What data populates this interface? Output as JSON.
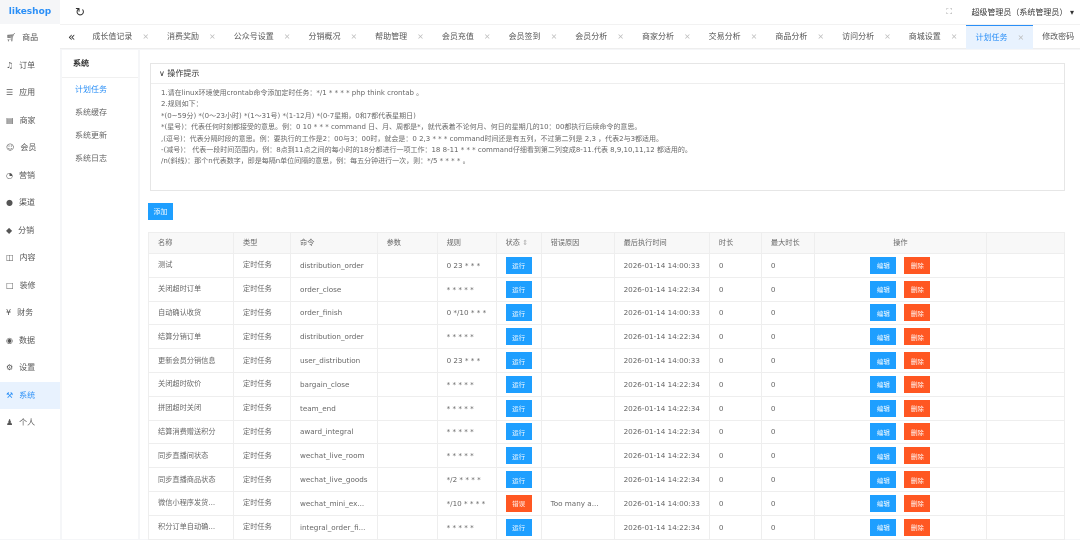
{
  "app": {
    "logo": "likeshop",
    "user": "超级管理员（系统管理员）"
  },
  "sidebar": {
    "items": [
      {
        "icon": "cart-icon",
        "label": "商品"
      },
      {
        "icon": "bell-icon",
        "label": "订单"
      },
      {
        "icon": "apps-icon",
        "label": "应用"
      },
      {
        "icon": "store-icon",
        "label": "商家"
      },
      {
        "icon": "user-icon",
        "label": "会员"
      },
      {
        "icon": "marketing-icon",
        "label": "营销"
      },
      {
        "icon": "channel-icon",
        "label": "渠道"
      },
      {
        "icon": "distribution-icon",
        "label": "分销"
      },
      {
        "icon": "content-icon",
        "label": "内容"
      },
      {
        "icon": "decor-icon",
        "label": "装修"
      },
      {
        "icon": "finance-icon",
        "label": "财务"
      },
      {
        "icon": "data-icon",
        "label": "数据"
      },
      {
        "icon": "settings-icon",
        "label": "设置"
      },
      {
        "icon": "system-icon",
        "label": "系统"
      },
      {
        "icon": "person-icon",
        "label": "个人"
      }
    ]
  },
  "submenu": {
    "title": "系统",
    "items": [
      "计划任务",
      "系统缓存",
      "系统更新",
      "系统日志"
    ]
  },
  "tabs": [
    "成长值记录",
    "消费奖励",
    "公众号设置",
    "分销概况",
    "帮助管理",
    "会员充值",
    "会员签到",
    "会员分析",
    "商家分析",
    "交易分析",
    "商品分析",
    "访问分析",
    "商城设置",
    "计划任务",
    "修改密码"
  ],
  "tips": {
    "title": "操作提示",
    "lines": [
      "1.请在linux环境使用crontab命令添加定时任务：*/1 * * * * php think crontab 。",
      "2.规则如下：",
      "*(0~59分) *(0～23小时) *(1～31号) *(1-12月) *(0-7星期，0和7都代表星期日)",
      "*(星号)：代表任何时刻都接受的意思。例：0 10 * * * command 日、月、周都是*，就代表着不论何月、何日的星期几的10：00都执行后续命令的意思。",
      ",(逗号)：代表分隔时段的意思。例：要执行的工作是2：00与3：00时，就会是：0 2,3 * * * command时间还是有五列，不过第二列是 2,3 ，代表2与3都适用。",
      "-(减号)： 代表一段时间范围内，例：8点到11点之间的每小时的18分都进行一项工作：18 8-11 * * * command仔细看到第二列变成8-11.代表 8,9,10,11,12 都适用的。",
      "/n(斜线)：那个n代表数字，即是每隔n单位间隔的意思，例：每五分钟进行一次，则：*/5 * * * * 。"
    ]
  },
  "add_label": "添加",
  "table": {
    "headers": [
      "名称",
      "类型",
      "命令",
      "参数",
      "规则",
      "状态",
      "错误原因",
      "最后执行时间",
      "时长",
      "最大时长",
      "操作"
    ],
    "edit_label": "编辑",
    "delete_label": "删除",
    "rows": [
      {
        "name": "测试",
        "type": "定时任务",
        "cmd": "distribution_order",
        "params": "",
        "rule": "0 23 * * *",
        "status": "运行",
        "error": "",
        "last": "2026-01-14 14:00:33",
        "dur": "0",
        "max": "0"
      },
      {
        "name": "关闭超时订单",
        "type": "定时任务",
        "cmd": "order_close",
        "params": "",
        "rule": "* * * * *",
        "status": "运行",
        "error": "",
        "last": "2026-01-14 14:22:34",
        "dur": "0",
        "max": "0"
      },
      {
        "name": "自动确认收货",
        "type": "定时任务",
        "cmd": "order_finish",
        "params": "",
        "rule": "0 */10 * * *",
        "status": "运行",
        "error": "",
        "last": "2026-01-14 14:00:33",
        "dur": "0",
        "max": "0"
      },
      {
        "name": "结算分销订单",
        "type": "定时任务",
        "cmd": "distribution_order",
        "params": "",
        "rule": "* * * * *",
        "status": "运行",
        "error": "",
        "last": "2026-01-14 14:22:34",
        "dur": "0",
        "max": "0"
      },
      {
        "name": "更新会员分销信息",
        "type": "定时任务",
        "cmd": "user_distribution",
        "params": "",
        "rule": "0 23 * * *",
        "status": "运行",
        "error": "",
        "last": "2026-01-14 14:00:33",
        "dur": "0",
        "max": "0"
      },
      {
        "name": "关闭超时砍价",
        "type": "定时任务",
        "cmd": "bargain_close",
        "params": "",
        "rule": "* * * * *",
        "status": "运行",
        "error": "",
        "last": "2026-01-14 14:22:34",
        "dur": "0",
        "max": "0"
      },
      {
        "name": "拼团超时关闭",
        "type": "定时任务",
        "cmd": "team_end",
        "params": "",
        "rule": "* * * * *",
        "status": "运行",
        "error": "",
        "last": "2026-01-14 14:22:34",
        "dur": "0",
        "max": "0"
      },
      {
        "name": "结算消费赠送积分",
        "type": "定时任务",
        "cmd": "award_integral",
        "params": "",
        "rule": "* * * * *",
        "status": "运行",
        "error": "",
        "last": "2026-01-14 14:22:34",
        "dur": "0",
        "max": "0"
      },
      {
        "name": "同步直播间状态",
        "type": "定时任务",
        "cmd": "wechat_live_room",
        "params": "",
        "rule": "* * * * *",
        "status": "运行",
        "error": "",
        "last": "2026-01-14 14:22:34",
        "dur": "0",
        "max": "0"
      },
      {
        "name": "同步直播商品状态",
        "type": "定时任务",
        "cmd": "wechat_live_goods",
        "params": "",
        "rule": "*/2 * * * *",
        "status": "运行",
        "error": "",
        "last": "2026-01-14 14:22:34",
        "dur": "0",
        "max": "0"
      },
      {
        "name": "微信小程序发货...",
        "type": "定时任务",
        "cmd": "wechat_mini_ex...",
        "params": "",
        "rule": "*/10 * * * *",
        "status": "错误",
        "error": "Too many a...",
        "last": "2026-01-14 14:00:33",
        "dur": "0",
        "max": "0"
      },
      {
        "name": "积分订单自动确...",
        "type": "定时任务",
        "cmd": "integral_order_fi...",
        "params": "",
        "rule": "* * * * *",
        "status": "运行",
        "error": "",
        "last": "2026-01-14 14:22:34",
        "dur": "0",
        "max": "0"
      }
    ]
  },
  "colors": {
    "accent": "#1e9fff",
    "danger": "#ff5722"
  }
}
